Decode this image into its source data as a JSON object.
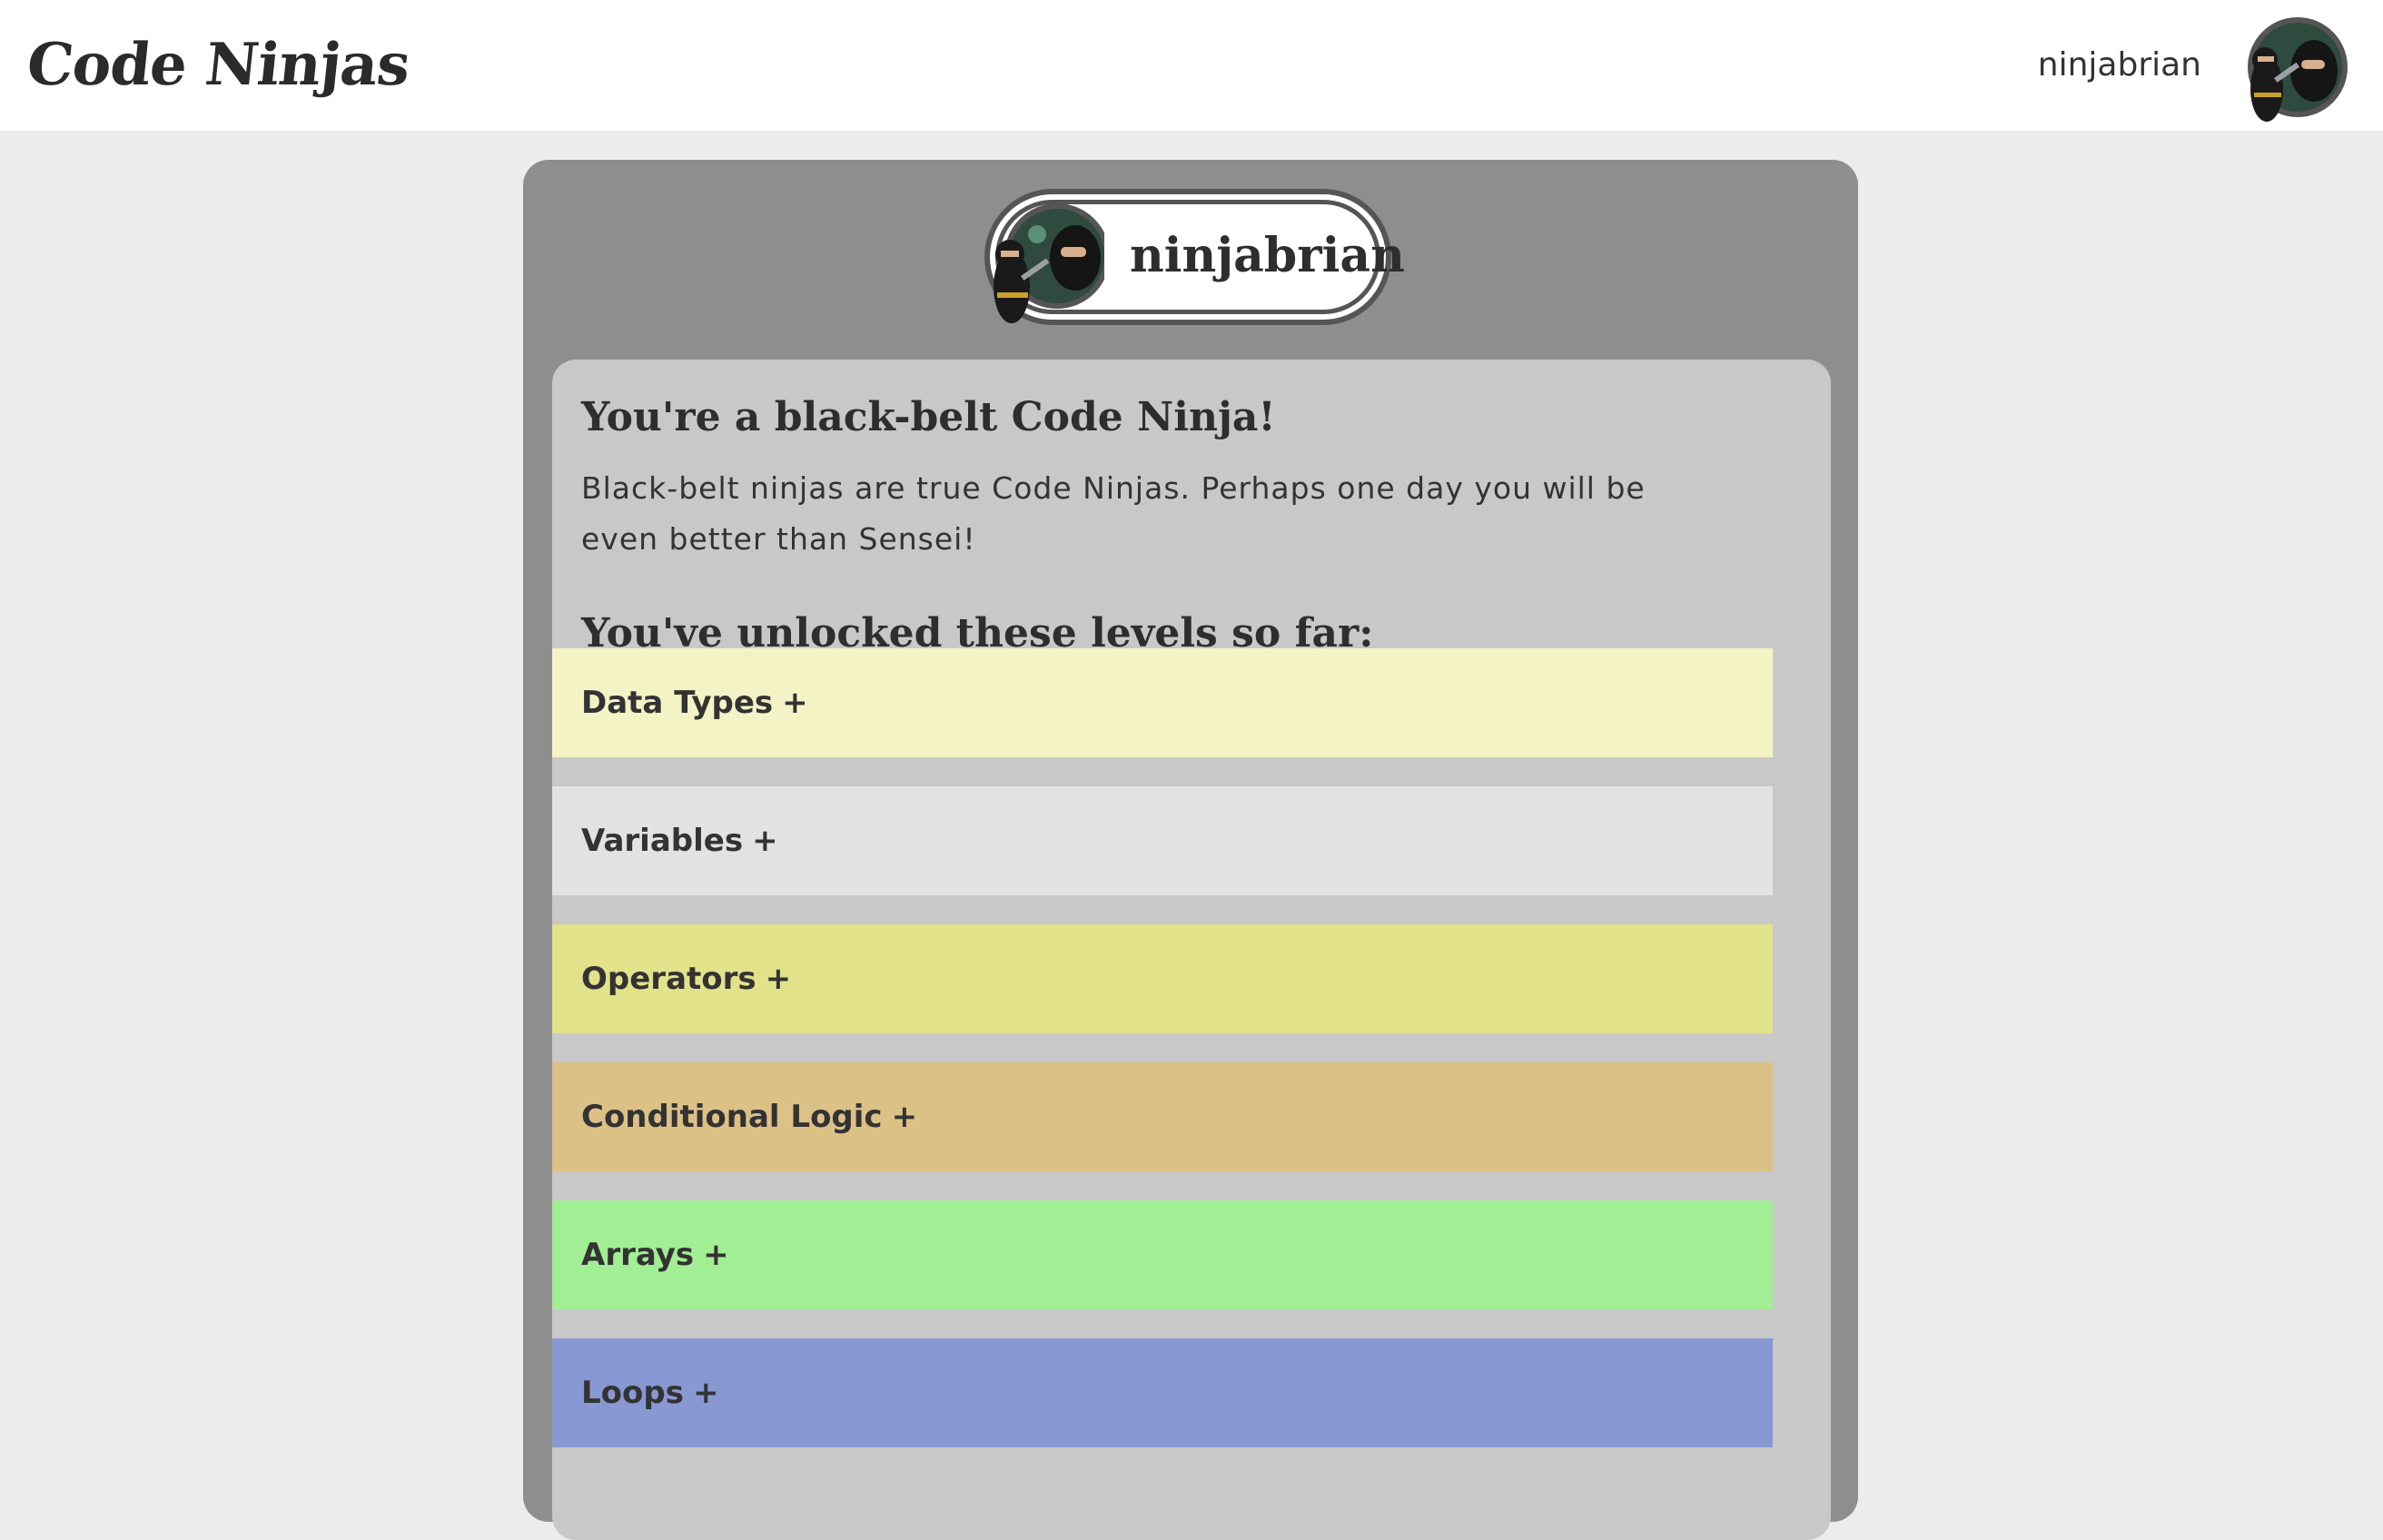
{
  "header": {
    "brand": "Code Ninjas",
    "username": "ninjabrian"
  },
  "profile": {
    "username": "ninjabrian",
    "rank_title": "You're a black-belt Code Ninja!",
    "rank_description": "Black-belt ninjas are true Code Ninjas. Perhaps one day you will be even better than Sensei!",
    "unlocked_title": "You've unlocked these levels so far:"
  },
  "levels": [
    {
      "label": "Data Types",
      "toggle": "+",
      "color": "#f4f3c6"
    },
    {
      "label": "Variables",
      "toggle": "+",
      "color": "#e2e2e2"
    },
    {
      "label": "Operators",
      "toggle": "+",
      "color": "#e2e28a"
    },
    {
      "label": "Conditional Logic",
      "toggle": "+",
      "color": "#dcc186"
    },
    {
      "label": "Arrays",
      "toggle": "+",
      "color": "#a1ee94"
    },
    {
      "label": "Loops",
      "toggle": "+",
      "color": "#8898d2"
    }
  ],
  "icons": {
    "avatar": "ninja-avatar-icon"
  }
}
